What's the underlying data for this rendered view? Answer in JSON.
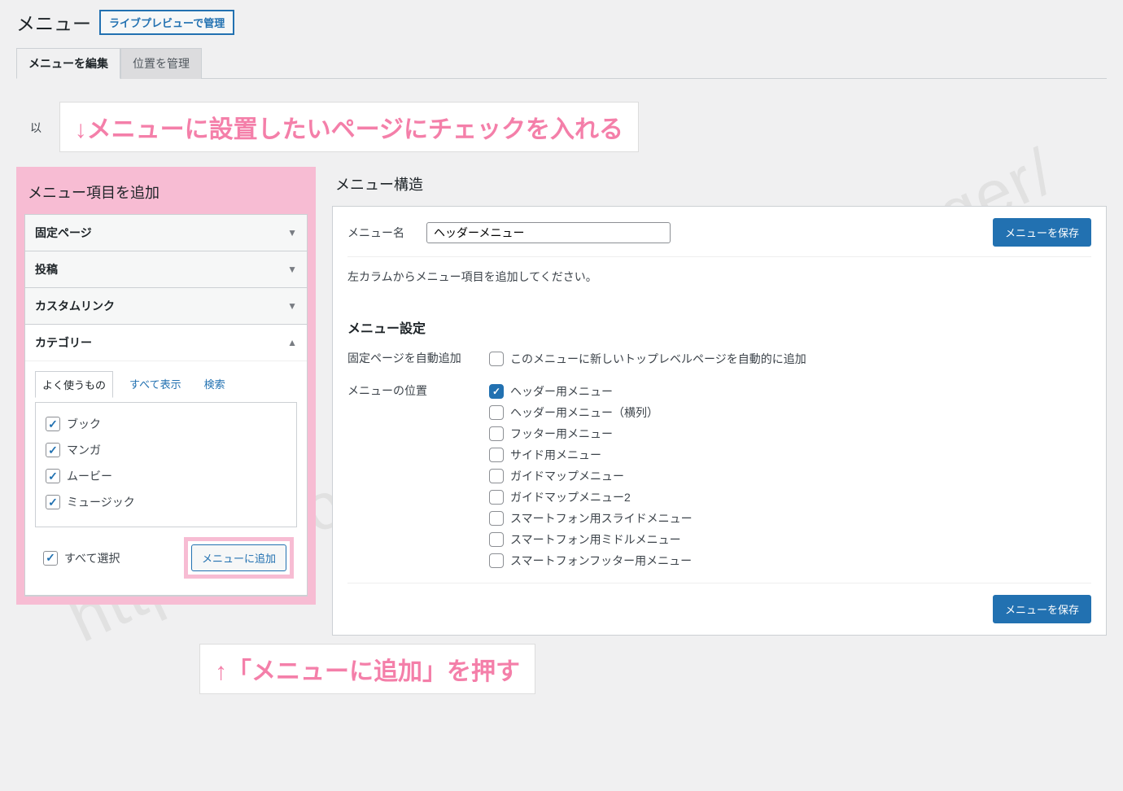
{
  "watermark": "https://wordpress-theme.jp/affinger/",
  "header": {
    "title": "メニュー",
    "manage_btn": "ライブプレビューで管理"
  },
  "tabs": {
    "edit": "メニューを編集",
    "locations": "位置を管理"
  },
  "intro_prefix": "以",
  "annotations": {
    "top": "↓メニューに設置したいページにチェックを入れる",
    "bottom": "↑「メニューに追加」を押す"
  },
  "left": {
    "heading": "メニュー項目を追加",
    "sections": {
      "pages": "固定ページ",
      "posts": "投稿",
      "custom": "カスタムリンク",
      "categories": "カテゴリー"
    },
    "subtabs": {
      "frequent": "よく使うもの",
      "all": "すべて表示",
      "search": "検索"
    },
    "items": [
      "ブック",
      "マンガ",
      "ムービー",
      "ミュージック"
    ],
    "select_all": "すべて選択",
    "add_btn": "メニューに追加"
  },
  "right": {
    "heading": "メニュー構造",
    "name_label": "メニュー名",
    "name_value": "ヘッダーメニュー",
    "save_btn": "メニューを保存",
    "empty_note": "左カラムからメニュー項目を追加してください。",
    "settings_heading": "メニュー設定",
    "auto_add_label": "固定ページを自動追加",
    "auto_add_desc": "このメニューに新しいトップレベルページを自動的に追加",
    "position_label": "メニューの位置",
    "positions": [
      "ヘッダー用メニュー",
      "ヘッダー用メニュー（横列）",
      "フッター用メニュー",
      "サイド用メニュー",
      "ガイドマップメニュー",
      "ガイドマップメニュー2",
      "スマートフォン用スライドメニュー",
      "スマートフォン用ミドルメニュー",
      "スマートフォンフッター用メニュー"
    ],
    "position_checked_index": 0
  }
}
